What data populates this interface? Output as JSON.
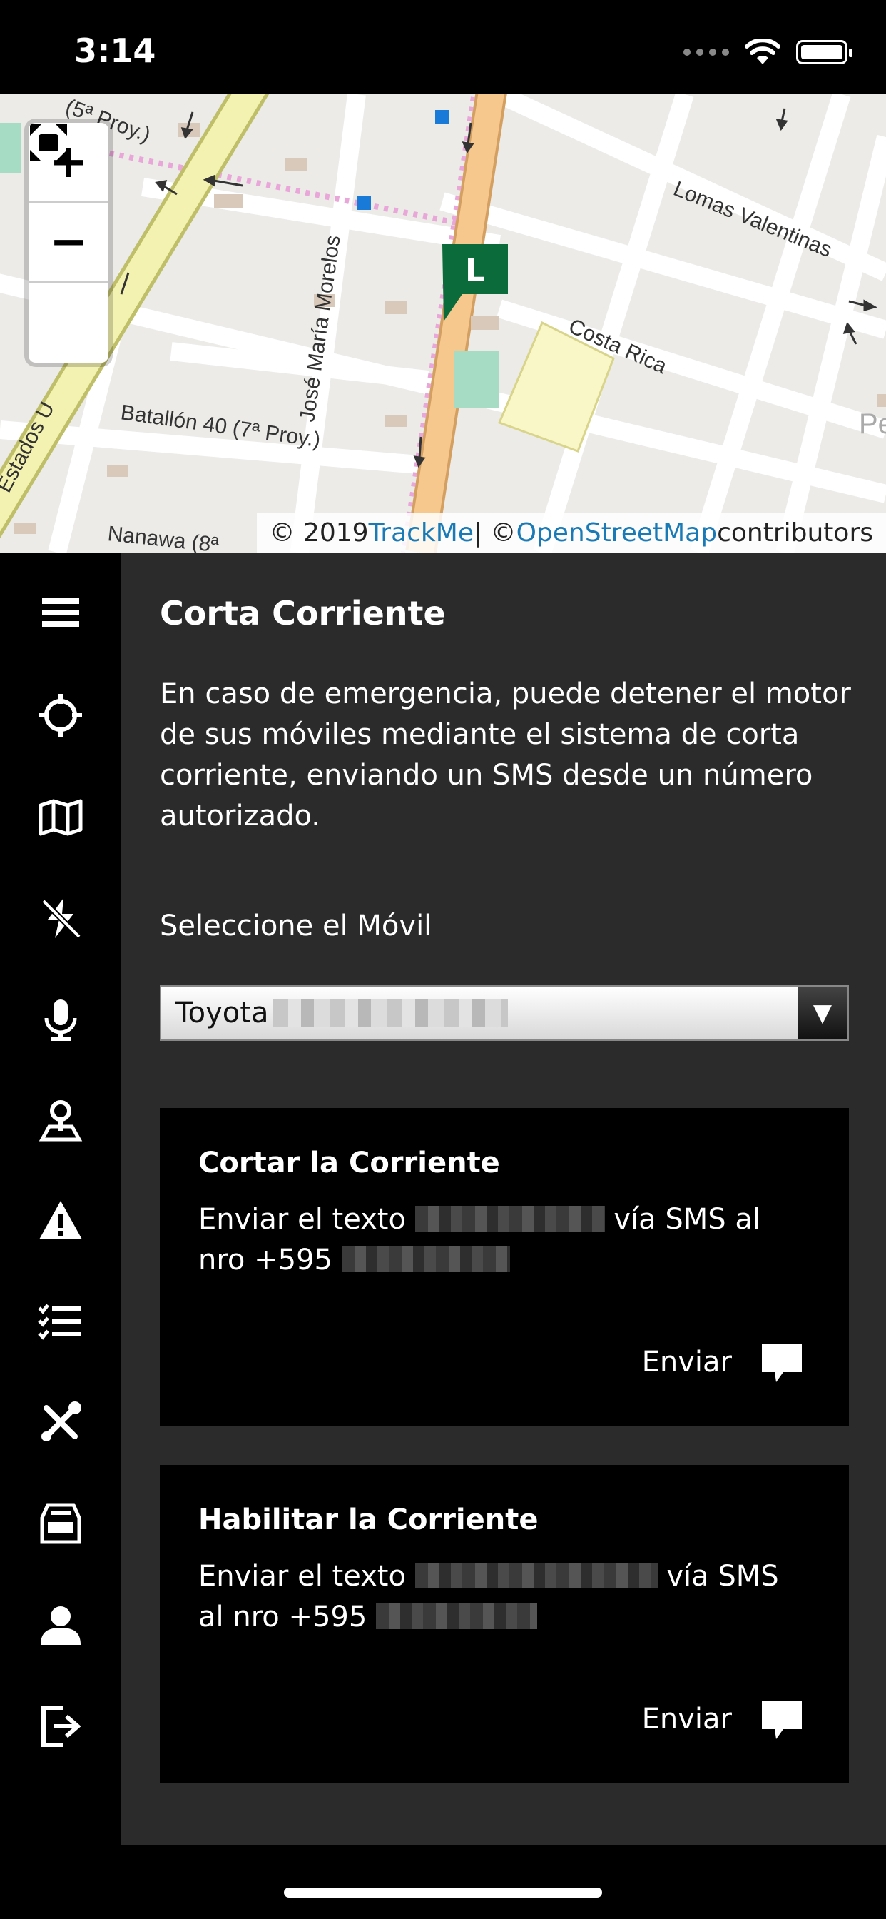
{
  "status": {
    "time": "3:14"
  },
  "map": {
    "zoom_in": "+",
    "zoom_out": "−",
    "marker_label": "L",
    "streets": {
      "proy5": "(5ª Proy.)",
      "lomas": "Lomas Valentinas",
      "costa": "Costa Rica",
      "jose": "José María Morelos",
      "batallon": "Batallón 40 (7ª Proy.)",
      "estados": "Estados U",
      "nanawa": "Nanawa (8ª",
      "pe": "Pe"
    },
    "attribution": {
      "prefix": "© 2019 ",
      "trackme": "TrackMe",
      "separator": " | © ",
      "osm": "OpenStreetMap",
      "suffix": " contributors"
    }
  },
  "sidebar": {
    "items": [
      {
        "icon": "menu-icon"
      },
      {
        "icon": "crosshair-icon"
      },
      {
        "icon": "map-icon"
      },
      {
        "icon": "flash-off-icon"
      },
      {
        "icon": "microphone-icon"
      },
      {
        "icon": "location-pin-icon"
      },
      {
        "icon": "warning-icon"
      },
      {
        "icon": "checklist-icon"
      },
      {
        "icon": "tools-icon"
      },
      {
        "icon": "inbox-icon"
      },
      {
        "icon": "user-icon"
      },
      {
        "icon": "logout-icon"
      }
    ]
  },
  "panel": {
    "title": "Corta Corriente",
    "description": "En caso de emergencia, puede detener el motor de sus móviles mediante el sistema de corta corriente, enviando un SMS desde un número autorizado.",
    "select_label": "Seleccione el Móvil",
    "selected_vehicle": "Toyota",
    "cards": [
      {
        "title": "Cortar la Corriente",
        "text_a": "Enviar el texto ",
        "text_b": " vía SMS al nro +595",
        "button": "Enviar"
      },
      {
        "title": "Habilitar la Corriente",
        "text_a": "Enviar el texto ",
        "text_b": " vía SMS al nro +595",
        "button": "Enviar"
      }
    ]
  },
  "colors": {
    "accent_blue": "#1a7ab5",
    "marker_green": "#0b6b3a",
    "panel_bg": "#2b2b2b"
  }
}
